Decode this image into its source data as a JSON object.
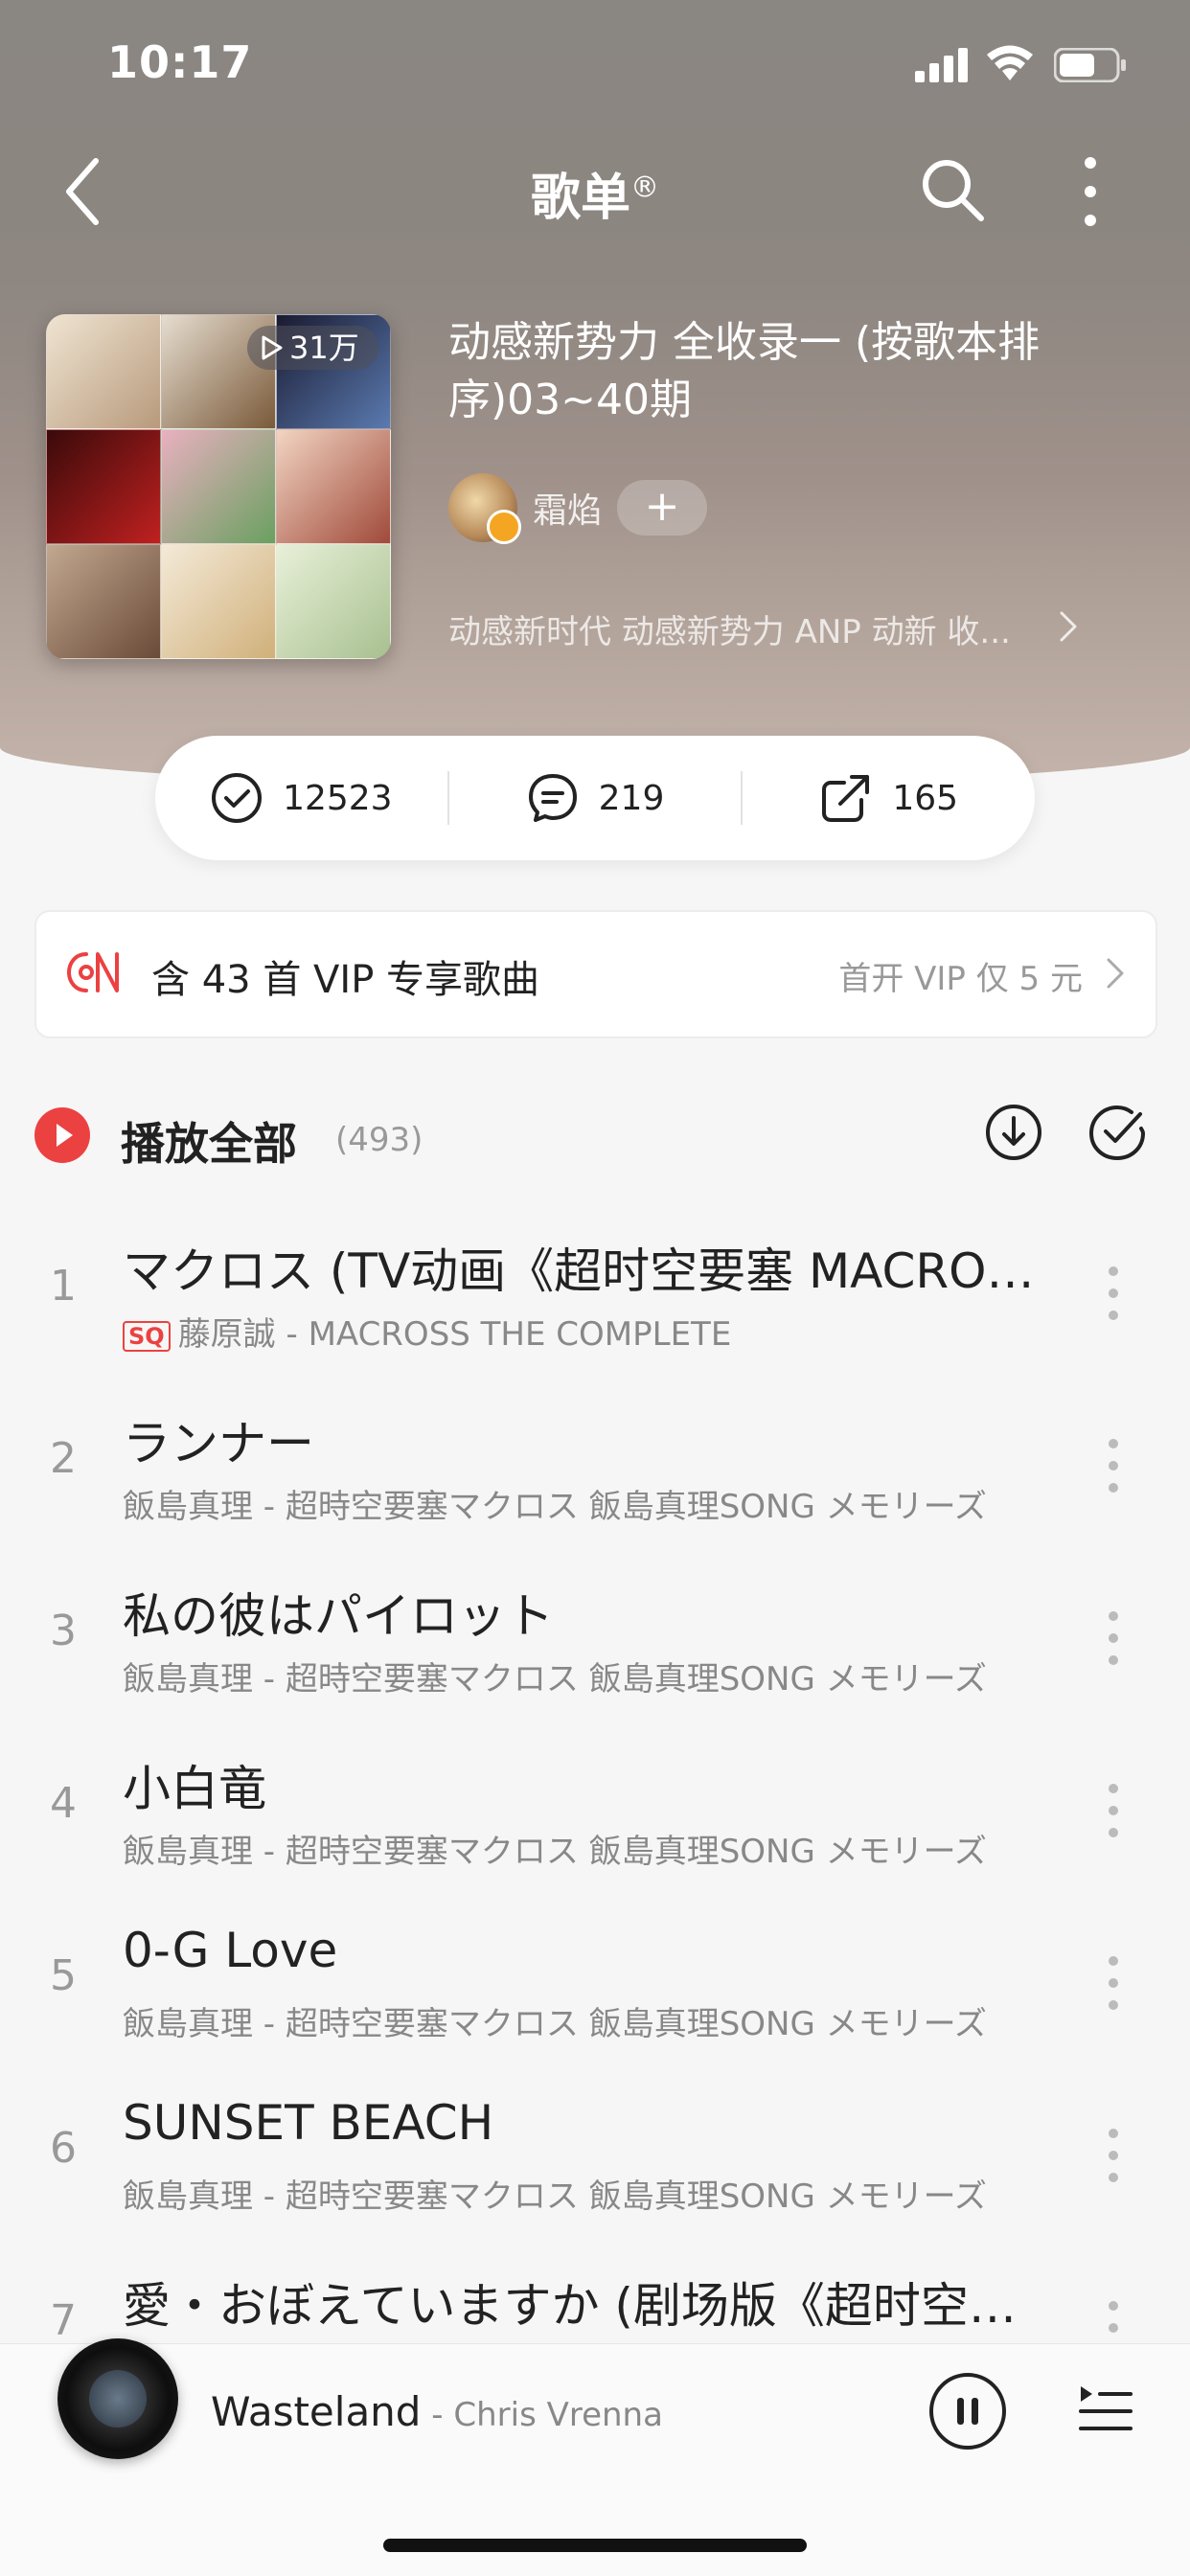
{
  "status_bar": {
    "time": "10:17"
  },
  "navbar": {
    "title": "歌单",
    "title_mark": "®"
  },
  "playlist": {
    "play_count": "31万",
    "title": "动感新势力 全收录一 (按歌本排序)03~40期",
    "creator": "霜焰",
    "follow_label": "+",
    "tags": "动感新时代 动感新势力 ANP 动新 收..."
  },
  "stats": {
    "collect": "12523",
    "comments": "219",
    "shares": "165"
  },
  "vip_banner": {
    "text": "含 43 首 VIP 专享歌曲",
    "offer": "首开 VIP 仅 5 元"
  },
  "play_all": {
    "label": "播放全部",
    "count": "(493)"
  },
  "songs": [
    {
      "num": "1",
      "title": "マクロス (TV动画《超时空要塞 MACROSS》片头曲)",
      "quality": "SQ",
      "subtitle": "藤原誠 - MACROSS THE COMPLETE"
    },
    {
      "num": "2",
      "title": "ランナー",
      "subtitle": "飯島真理 - 超時空要塞マクロス 飯島真理SONG メモリーズ"
    },
    {
      "num": "3",
      "title": "私の彼はパイロット",
      "subtitle": "飯島真理 - 超時空要塞マクロス 飯島真理SONG メモリーズ"
    },
    {
      "num": "4",
      "title": "小白竜",
      "subtitle": "飯島真理 - 超時空要塞マクロス 飯島真理SONG メモリーズ"
    },
    {
      "num": "5",
      "title": "0-G Love",
      "subtitle": "飯島真理 - 超時空要塞マクロス 飯島真理SONG メモリーズ"
    },
    {
      "num": "6",
      "title": "SUNSET BEACH",
      "subtitle": "飯島真理 - 超時空要塞マクロス 飯島真理SONG メモリーズ"
    },
    {
      "num": "7",
      "title": "愛・おぼえていますか (剧场版《超时空要塞》主题曲)",
      "subtitle": ""
    }
  ],
  "mini_player": {
    "title": "Wasteland",
    "artist": " - Chris Vrenna"
  },
  "colors": {
    "accent": "#ec4141"
  }
}
